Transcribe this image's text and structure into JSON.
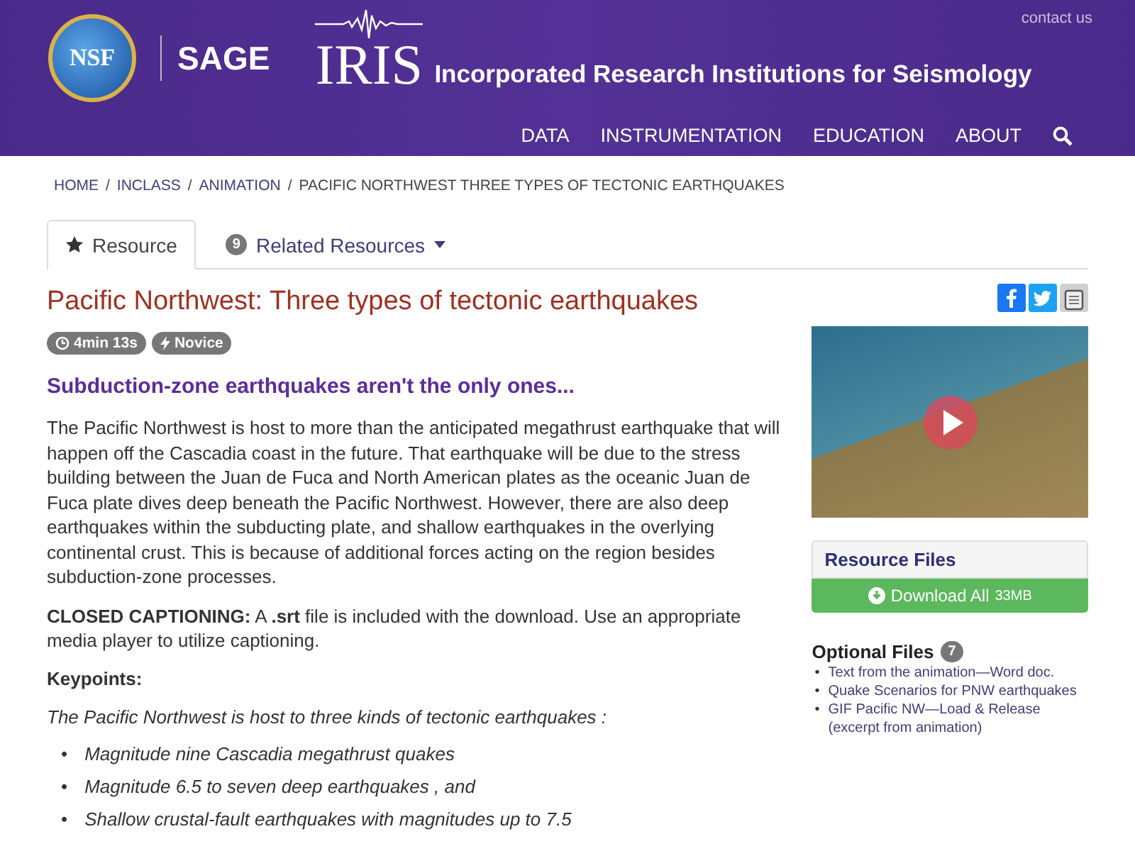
{
  "header": {
    "contact_link": "contact us",
    "logos": {
      "nsf": "NSF",
      "sage": "SAGE",
      "iris": "IRIS"
    },
    "site_title": "Incorporated Research Institutions for Seismology",
    "nav": [
      "DATA",
      "INSTRUMENTATION",
      "EDUCATION",
      "ABOUT"
    ]
  },
  "breadcrumb": [
    {
      "label": "HOME",
      "link": true
    },
    {
      "separator": "/",
      "label": "INCLASS",
      "link": true
    },
    {
      "separator": "/",
      "label": "ANIMATION",
      "link": true
    },
    {
      "separator": "/",
      "label": "PACIFIC NORTHWEST THREE TYPES OF TECTONIC EARTHQUAKES",
      "link": false
    }
  ],
  "tabs": [
    {
      "kind": "star",
      "label": "Resource",
      "selected": true
    },
    {
      "kind": "count",
      "label": "Related Resources",
      "count": "9",
      "selected": false
    }
  ],
  "title": "Pacific Northwest: Three types of tectonic earthquakes",
  "badges": [
    {
      "kind": "time",
      "label": "4min 13s"
    },
    {
      "kind": "level",
      "label": "Novice"
    }
  ],
  "heading": "Subduction-zone earthquakes aren't the only ones...",
  "paragraphs": [
    "The Pacific Northwest is host to more than the anticipated megathrust earthquake that will happen off the Cascadia coast in the future. That earthquake will be due to the stress building between the Juan de Fuca and North American plates as the oceanic Juan de Fuca plate dives deep beneath the Pacific Northwest. However, there are also deep earthquakes within the subducting plate, and shallow earthquakes in the overlying continental crust. This is because of additional forces acting on the region besides subduction-zone processes.",
    "**CLOSED CAPTIONING:** A **.srt** file is included with the download. Use an appropriate media player to utilize captioning."
  ],
  "keypoints": {
    "heading": "Keypoints:",
    "intro": "The Pacific Northwest is host to three kinds of tectonic earthquakes :",
    "items": [
      {
        "marker": "•",
        "text": "Magnitude nine Cascadia megathrust quakes"
      },
      {
        "marker": "•",
        "text": "Magnitude 6.5 to seven deep earthquakes , and"
      },
      {
        "marker": "•",
        "text": "Shallow crustal-fault earthquakes with magnitudes up to 7.5"
      }
    ]
  },
  "sidebar": {
    "resource_files": "Resource Files",
    "download": {
      "label": "Download All",
      "size": "33MB"
    },
    "optional_files": {
      "title": "Optional Files",
      "count": "7",
      "links": [
        {
          "marker": "•",
          "text": "Text from the animation—Word doc."
        },
        {
          "marker": "•",
          "text": "Quake Scenarios for PNW earthquakes"
        },
        {
          "marker": "•",
          "text": "GIF Pacific NW—Load & Release (excerpt from animation)"
        }
      ]
    }
  }
}
